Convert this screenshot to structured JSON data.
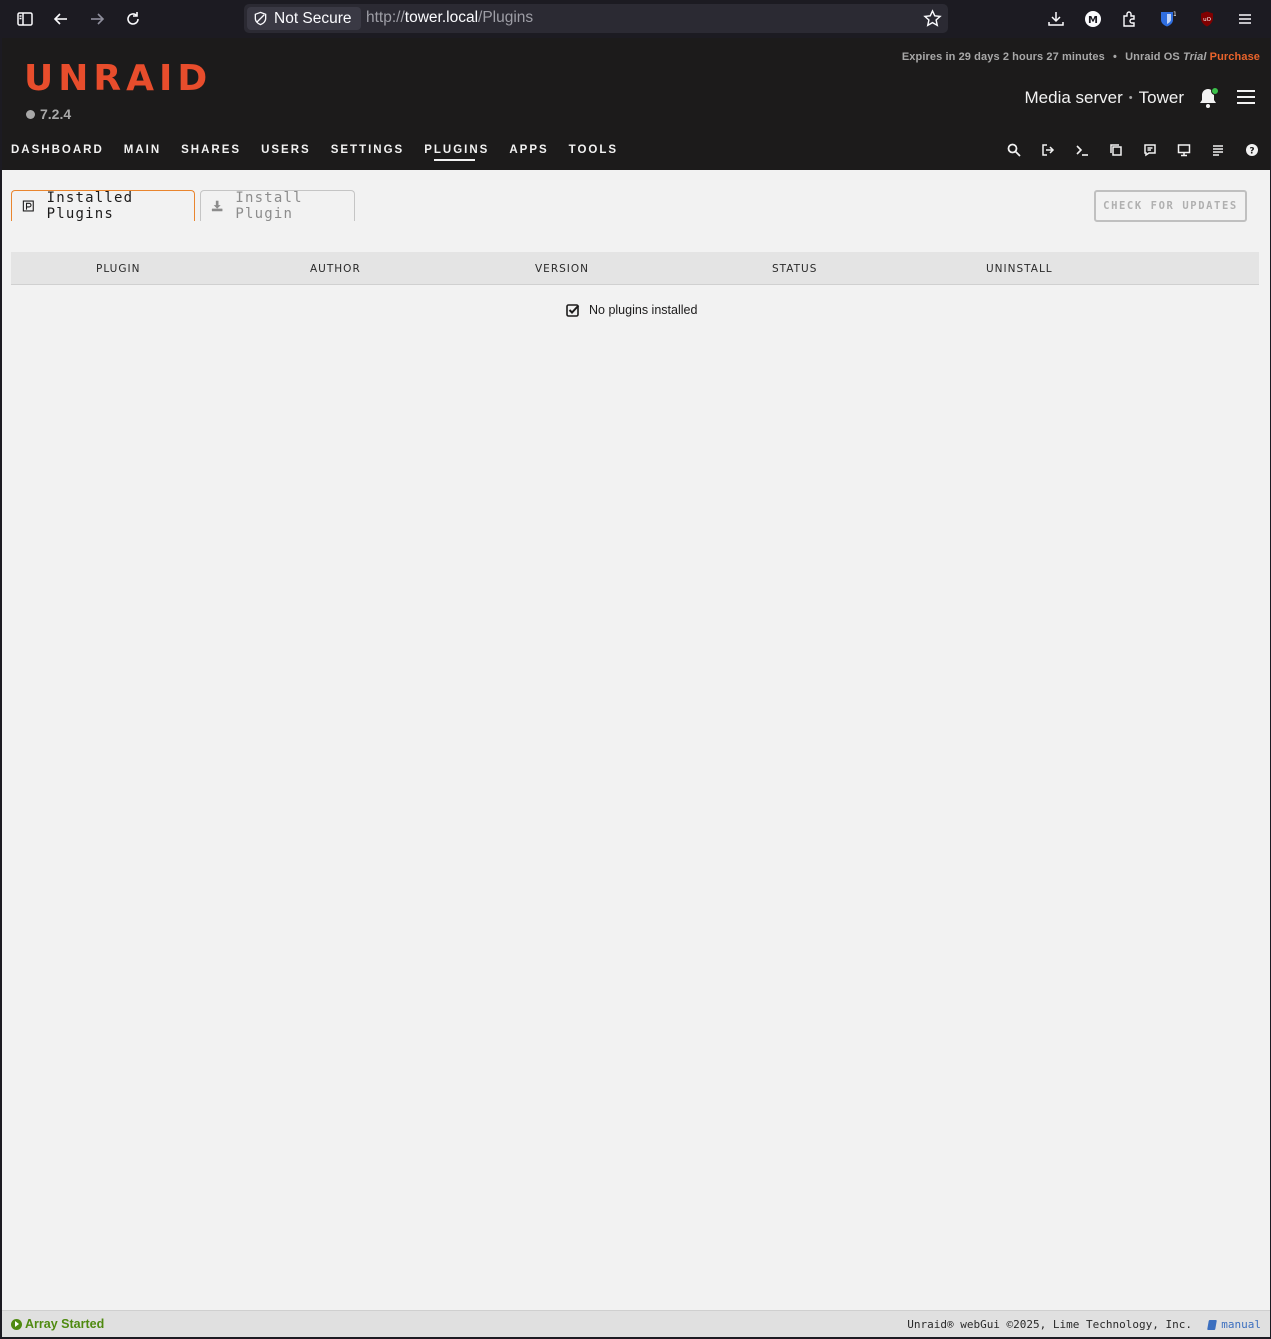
{
  "browser": {
    "security_label": "Not Secure",
    "url_scheme": "http://",
    "url_host": "tower.local",
    "url_path": "/Plugins"
  },
  "header": {
    "trial_prefix": "Expires in 29 days 2 hours 27 minutes",
    "trial_bullet": "•",
    "trial_os": "Unraid OS",
    "trial_type": "Trial",
    "purchase_label": "Purchase",
    "logo": "UNRAID",
    "version": "7.2.4",
    "server_description": "Media server",
    "server_separator": "•",
    "server_name": "Tower",
    "accent_color": "#e84d2c"
  },
  "nav": {
    "items": [
      {
        "label": "DASHBOARD"
      },
      {
        "label": "MAIN"
      },
      {
        "label": "SHARES"
      },
      {
        "label": "USERS"
      },
      {
        "label": "SETTINGS"
      },
      {
        "label": "PLUGINS",
        "active": true
      },
      {
        "label": "APPS"
      },
      {
        "label": "TOOLS"
      }
    ],
    "icons": [
      "search-icon",
      "logout-icon",
      "terminal-icon",
      "copy-icon",
      "feedback-icon",
      "display-icon",
      "log-icon",
      "help-icon"
    ]
  },
  "tabs": [
    {
      "label": "Installed Plugins",
      "active": true,
      "icon": "plugin-icon"
    },
    {
      "label": "Install Plugin",
      "active": false,
      "icon": "download-icon"
    }
  ],
  "check_updates_label": "CHECK FOR UPDATES",
  "table": {
    "columns": [
      "PLUGIN",
      "AUTHOR",
      "VERSION",
      "STATUS",
      "UNINSTALL"
    ],
    "empty_message": "No plugins installed"
  },
  "footer": {
    "array_status": "Array Started",
    "copyright": "Unraid® webGui ©2025, Lime Technology, Inc.",
    "manual_label": "manual"
  }
}
